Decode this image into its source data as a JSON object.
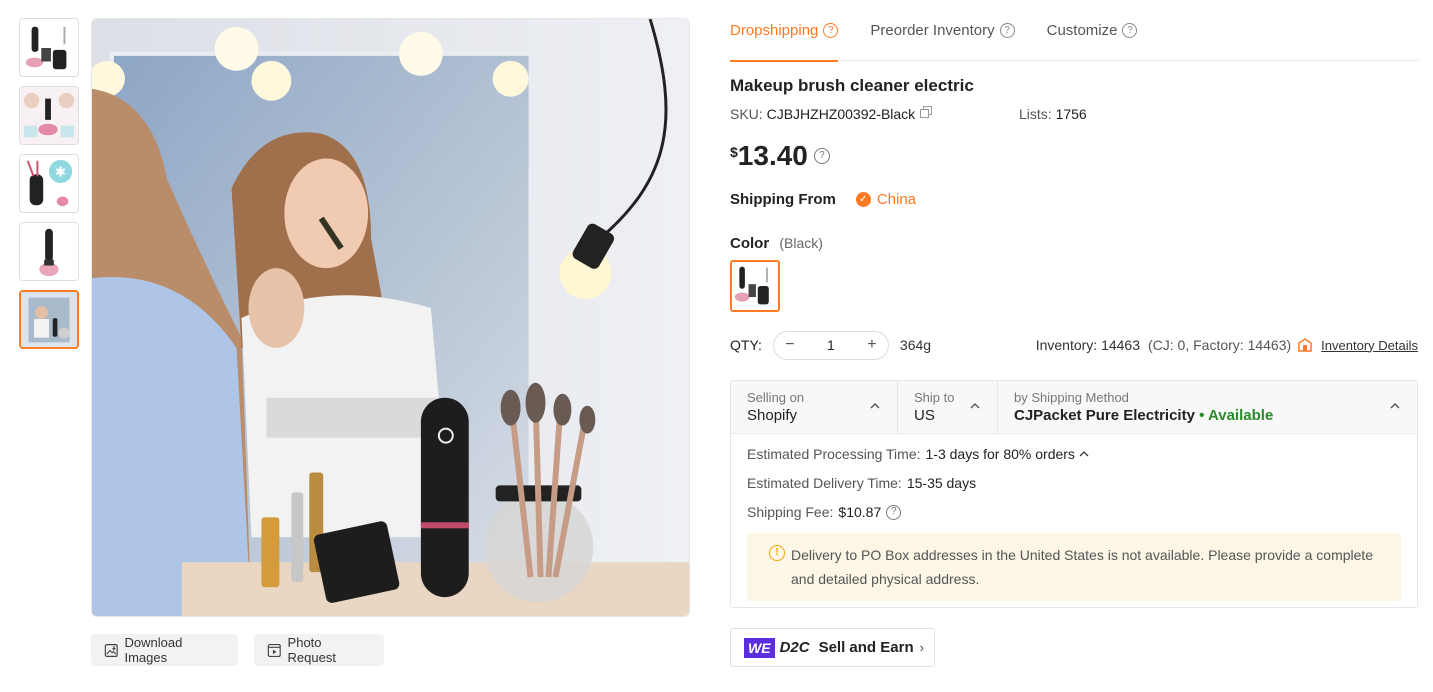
{
  "tabs": [
    {
      "label": "Dropshipping",
      "active": true
    },
    {
      "label": "Preorder Inventory",
      "active": false
    },
    {
      "label": "Customize",
      "active": false
    }
  ],
  "product": {
    "title": "Makeup brush cleaner electric",
    "sku_label": "SKU:",
    "sku_value": "CJBJHZHZ00392-Black",
    "lists_label": "Lists:",
    "lists_value": "1756",
    "currency": "$",
    "price": "13.40"
  },
  "shipping_from": {
    "label": "Shipping From",
    "country": "China"
  },
  "color": {
    "label": "Color",
    "selected": "(Black)"
  },
  "qty": {
    "label": "QTY:",
    "value": "1",
    "minus": "−",
    "plus": "+",
    "weight": "364g"
  },
  "inventory": {
    "label": "Inventory: 14463",
    "breakdown": "(CJ: 0, Factory: 14463)",
    "link": "Inventory Details"
  },
  "shipping": {
    "selling_on_label": "Selling on",
    "selling_on_value": "Shopify",
    "ship_to_label": "Ship to",
    "ship_to_value": "US",
    "method_label": "by Shipping Method",
    "method_value": "CJPacket Pure Electricity",
    "method_status": "• Available",
    "processing_label": "Estimated Processing Time:",
    "processing_value": "1-3 days for 80% orders",
    "delivery_label": "Estimated Delivery Time:",
    "delivery_value": "15-35 days",
    "fee_label": "Shipping Fee:",
    "fee_value": "$10.87",
    "notice": "Delivery to PO Box addresses in the United States is not available. Please provide a complete and detailed physical address."
  },
  "image_buttons": {
    "download": "Download Images",
    "photo_request": "Photo Request"
  },
  "d2c": {
    "we": "WE",
    "d2c": "D2C",
    "sell": "Sell and Earn"
  },
  "colors": {
    "accent": "#ff7a22",
    "available": "#2a8a2a",
    "brand_purple": "#5b2ee0",
    "notice_bg": "#fcf6e6"
  }
}
